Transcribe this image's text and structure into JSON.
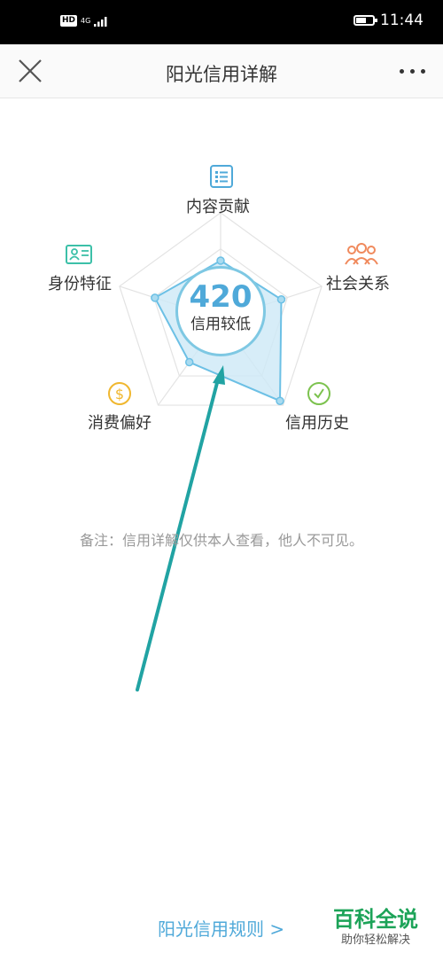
{
  "status_bar": {
    "hd": "HD",
    "network": "4G",
    "battery_level": 0.6,
    "time": "11:44"
  },
  "nav": {
    "title": "阳光信用详解",
    "close_icon": "close-icon",
    "more_icon": "more-dots-icon"
  },
  "radar": {
    "dimensions": [
      {
        "label": "内容贡献",
        "icon": "list-icon",
        "color": "#4fa9d9",
        "value": 0.55
      },
      {
        "label": "社会关系",
        "icon": "people-icon",
        "color": "#f08a5d",
        "value": 0.6
      },
      {
        "label": "信用历史",
        "icon": "clock-icon",
        "color": "#7cc24e",
        "value": 0.95
      },
      {
        "label": "消费偏好",
        "icon": "dollar-icon",
        "color": "#f0b72f",
        "value": 0.5
      },
      {
        "label": "身份特征",
        "icon": "id-card-icon",
        "color": "#3cc0a8",
        "value": 0.65
      }
    ],
    "fill_color": "#cde9f6",
    "line_color": "#6cc0e5"
  },
  "score": {
    "value": "420",
    "level": "信用较低"
  },
  "note": "备注：信用详解仅供本人查看，他人不可见。",
  "rules_link": "阳光信用规则 >",
  "watermark": {
    "title": "百科全说",
    "subtitle": "助你轻松解决"
  }
}
